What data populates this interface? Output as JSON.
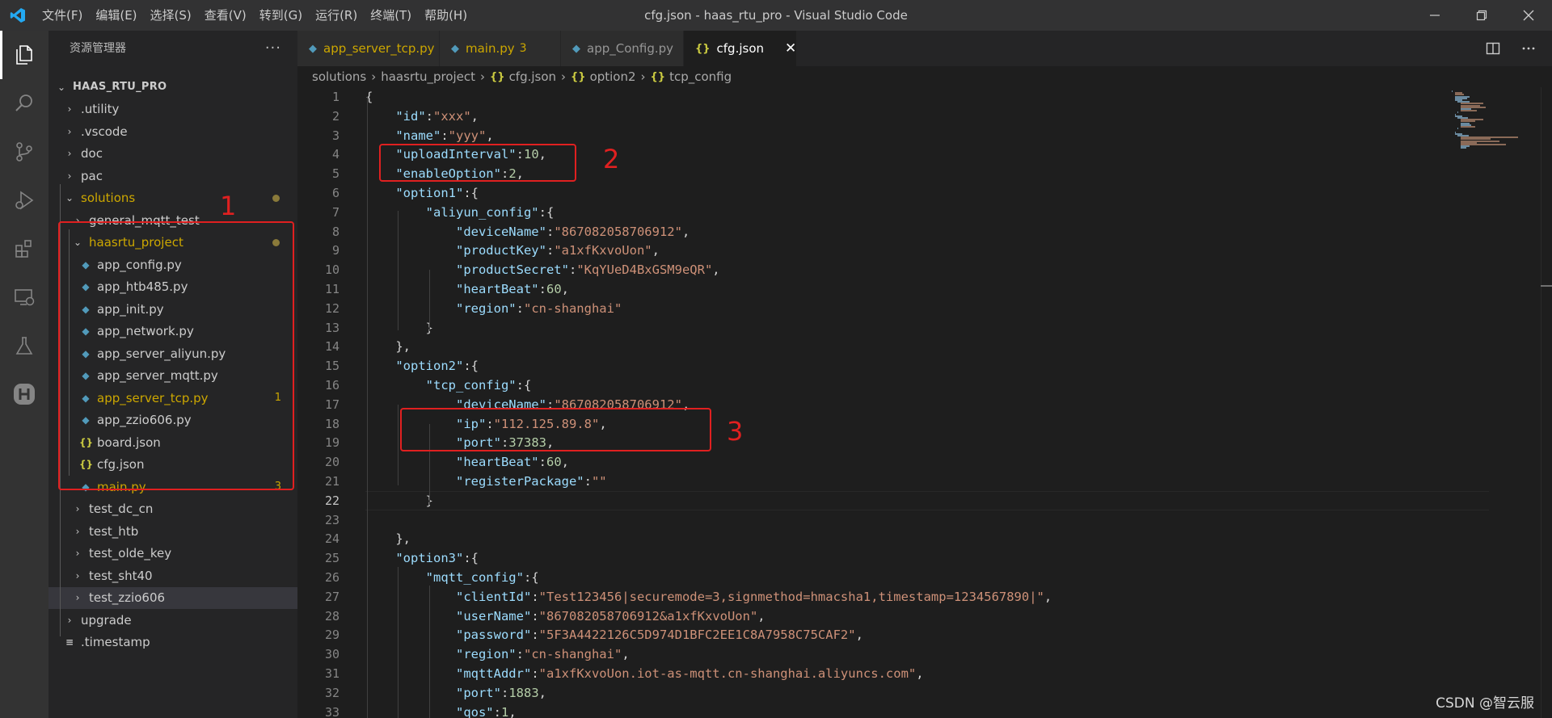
{
  "window": {
    "title": "cfg.json - haas_rtu_pro - Visual Studio Code",
    "menu": [
      "文件(F)",
      "编辑(E)",
      "选择(S)",
      "查看(V)",
      "转到(G)",
      "运行(R)",
      "终端(T)",
      "帮助(H)"
    ]
  },
  "sidebar": {
    "header": "资源管理器",
    "more": "···",
    "tree": [
      {
        "label": "HAAS_RTU_PRO",
        "chevron": "⌄",
        "kind": "root"
      },
      {
        "label": ".utility",
        "chevron": "›",
        "kind": "folder"
      },
      {
        "label": ".vscode",
        "chevron": "›",
        "kind": "folder"
      },
      {
        "label": "doc",
        "chevron": "›",
        "kind": "folder"
      },
      {
        "label": "pac",
        "chevron": "›",
        "kind": "folder"
      },
      {
        "label": "solutions",
        "chevron": "⌄",
        "kind": "folder",
        "modified": true
      },
      {
        "label": "general_mqtt_test",
        "chevron": "›",
        "kind": "folder"
      },
      {
        "label": "haasrtu_project",
        "chevron": "⌄",
        "kind": "folder",
        "modified": true
      },
      {
        "label": "app_config.py",
        "kind": "py"
      },
      {
        "label": "app_htb485.py",
        "kind": "py"
      },
      {
        "label": "app_init.py",
        "kind": "py"
      },
      {
        "label": "app_network.py",
        "kind": "py"
      },
      {
        "label": "app_server_aliyun.py",
        "kind": "py"
      },
      {
        "label": "app_server_mqtt.py",
        "kind": "py"
      },
      {
        "label": "app_server_tcp.py",
        "kind": "py",
        "badge": "1"
      },
      {
        "label": "app_zzio606.py",
        "kind": "py"
      },
      {
        "label": "board.json",
        "kind": "json"
      },
      {
        "label": "cfg.json",
        "kind": "json"
      },
      {
        "label": "main.py",
        "kind": "py",
        "badge": "3"
      },
      {
        "label": "test_dc_cn",
        "chevron": "›",
        "kind": "folder"
      },
      {
        "label": "test_htb",
        "chevron": "›",
        "kind": "folder"
      },
      {
        "label": "test_olde_key",
        "chevron": "›",
        "kind": "folder"
      },
      {
        "label": "test_sht40",
        "chevron": "›",
        "kind": "folder"
      },
      {
        "label": "test_zzio606",
        "chevron": "›",
        "kind": "folder",
        "selected": true
      },
      {
        "label": "upgrade",
        "chevron": "›",
        "kind": "folder"
      },
      {
        "label": ".timestamp",
        "kind": "file"
      }
    ]
  },
  "tabs": [
    {
      "label": "app_server_tcp.py",
      "kind": "py",
      "badge": "1",
      "modified": true
    },
    {
      "label": "main.py",
      "kind": "py",
      "badge": "3",
      "modified": true
    },
    {
      "label": "app_Config.py",
      "kind": "py"
    },
    {
      "label": "cfg.json",
      "kind": "json",
      "active": true,
      "close": "✕"
    }
  ],
  "breadcrumb": {
    "items": [
      "solutions",
      "haasrtu_project",
      "cfg.json",
      "option2",
      "tcp_config"
    ],
    "sep": "›",
    "json_icon": "{}"
  },
  "editor": {
    "current_line": 22,
    "lines": [
      "{",
      "    \"id\":\"xxx\",",
      "    \"name\":\"yyy\",",
      "    \"uploadInterval\":10,",
      "    \"enableOption\":2,",
      "    \"option1\":{",
      "        \"aliyun_config\":{",
      "            \"deviceName\":\"867082058706912\",",
      "            \"productKey\":\"a1xfKxvoUon\",",
      "            \"productSecret\":\"KqYUeD4BxGSM9eQR\",",
      "            \"heartBeat\":60,",
      "            \"region\":\"cn-shanghai\"",
      "        }",
      "    },",
      "    \"option2\":{",
      "        \"tcp_config\":{",
      "            \"deviceName\":\"867082058706912\",",
      "            \"ip\":\"112.125.89.8\",",
      "            \"port\":37383,",
      "            \"heartBeat\":60,",
      "            \"registerPackage\":\"\"",
      "        }",
      "",
      "    },",
      "    \"option3\":{",
      "        \"mqtt_config\":{",
      "            \"clientId\":\"Test123456|securemode=3,signmethod=hmacsha1,timestamp=1234567890|\",",
      "            \"userName\":\"867082058706912&a1xfKxvoUon\",",
      "            \"password\":\"5F3A4422126C5D974D1BFC2EE1C8A7958C75CAF2\",",
      "            \"region\":\"cn-shanghai\",",
      "            \"mqttAddr\":\"a1xfKxvoUon.iot-as-mqtt.cn-shanghai.aliyuncs.com\",",
      "            \"port\":1883,",
      "            \"qos\":1,"
    ]
  },
  "annotations": [
    "1",
    "2",
    "3"
  ],
  "watermark": "CSDN @智云服",
  "colors": {
    "accent": "#007acc",
    "annotation": "#e02020",
    "modified": "#cca700",
    "json_key": "#9cdcfe",
    "json_string": "#ce9178",
    "json_number": "#b5cea8"
  }
}
